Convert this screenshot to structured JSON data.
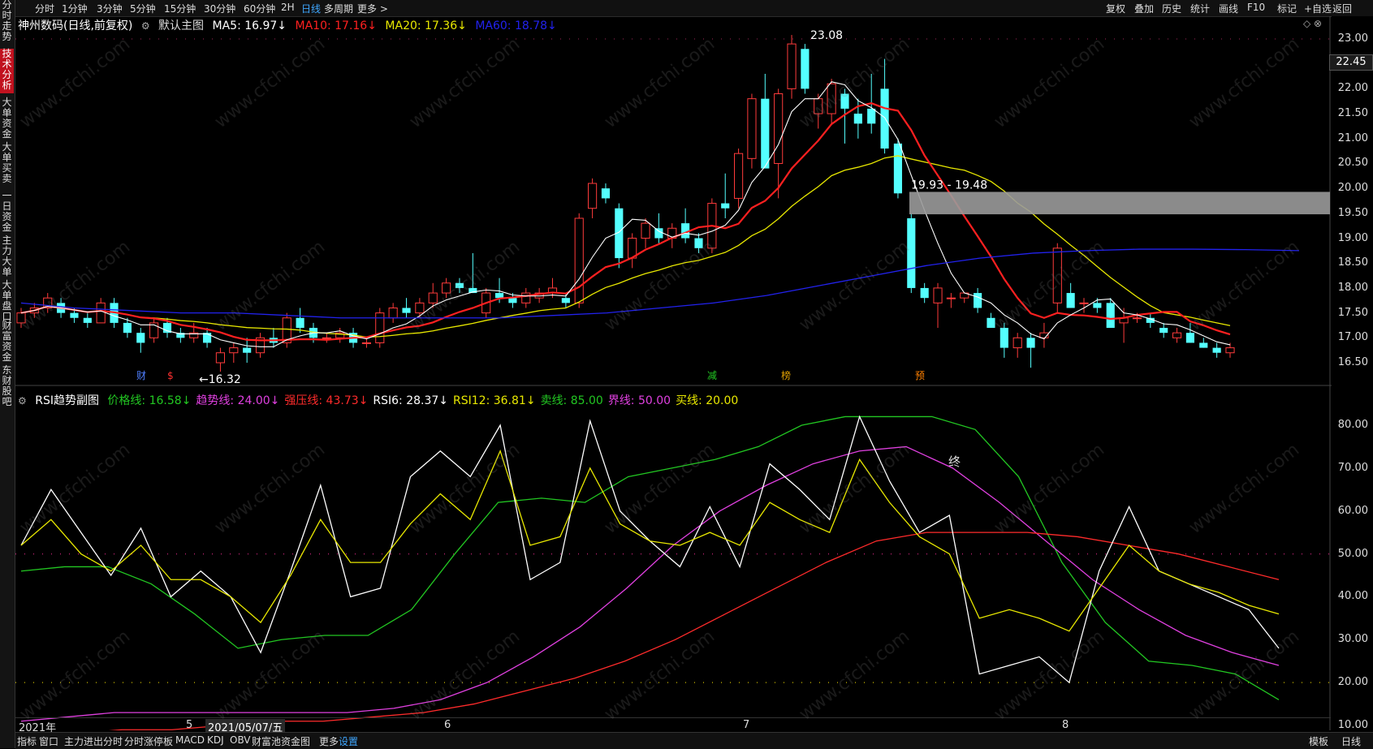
{
  "left_tabs": [
    {
      "label": "分时走势",
      "active": false
    },
    {
      "label": "技术分析",
      "active": true
    },
    {
      "label": "大单资金",
      "active": false
    },
    {
      "label": "大单买卖",
      "active": false
    },
    {
      "label": "一日资金",
      "active": false
    },
    {
      "label": "主力大单",
      "active": false
    },
    {
      "label": "大单盘口",
      "active": false
    },
    {
      "label": "财富资金",
      "active": false
    },
    {
      "label": "东财股吧",
      "active": false
    }
  ],
  "toolbar": {
    "periods": [
      "分时",
      "1分钟",
      "3分钟",
      "5分钟",
      "15分钟",
      "30分钟",
      "60分钟",
      "2H",
      "日线",
      "多周期",
      "更多 >"
    ],
    "active_period": "日线",
    "right": [
      "复权",
      "叠加",
      "历史",
      "统计",
      "画线",
      "F10",
      "标记",
      "+自选",
      "返回"
    ]
  },
  "main_legend": {
    "title": "神州数码(日线,前复权)",
    "indicator": "默认主图",
    "ma5": "MA5: 16.97↓",
    "ma10": "MA10: 17.16↓",
    "ma20": "MA20: 17.36↓",
    "ma60": "MA60: 18.78↓"
  },
  "sub_legend": {
    "title": "RSI趋势副图",
    "items": [
      {
        "text": "价格线: 16.58↓",
        "color": "#22c722"
      },
      {
        "text": "趋势线: 24.00↓",
        "color": "#e040e0"
      },
      {
        "text": "强压线: 43.73↓",
        "color": "#ff2b2b"
      },
      {
        "text": "RSI6: 28.37↓",
        "color": "#ffffff"
      },
      {
        "text": "RSI12: 36.81↓",
        "color": "#e8e800"
      },
      {
        "text": "卖线: 85.00",
        "color": "#22c722"
      },
      {
        "text": "界线: 50.00",
        "color": "#e040e0"
      },
      {
        "text": "买线: 20.00",
        "color": "#e8e800"
      }
    ]
  },
  "price_axis": [
    "23.00",
    "22.50",
    "22.00",
    "21.50",
    "21.00",
    "20.50",
    "20.00",
    "19.50",
    "19.00",
    "18.50",
    "18.00",
    "17.50",
    "17.00",
    "16.50"
  ],
  "current_price": "22.45",
  "rsi_axis": [
    "80.00",
    "70.00",
    "60.00",
    "50.00",
    "40.00",
    "30.00",
    "20.00",
    "10.00"
  ],
  "annotations": {
    "high": "23.08",
    "low": "←16.32",
    "gap": "19.93 - 19.48",
    "end_mark": "终",
    "markers": [
      "财",
      "$",
      "减",
      "榜",
      "预"
    ]
  },
  "date_axis": [
    "2021年",
    "5",
    "2021/05/07/五",
    "6",
    "7",
    "8"
  ],
  "bottom_tabs": [
    "指标",
    "窗口",
    "主力进出分时",
    "分时涨停板",
    "MACD",
    "KDJ",
    "OBV",
    "财富池资金图",
    "更多",
    "设置"
  ],
  "bottom_active": "设置",
  "bottom_right": [
    "模板",
    "日线"
  ],
  "watermark": "www.cfchi.com",
  "colors": {
    "up": "#ff3b3b",
    "down": "#54ffff",
    "ma5": "#ffffff",
    "ma10": "#ff2020",
    "ma20": "#e8e800",
    "ma60": "#2222ee"
  },
  "chart_data": {
    "type": "candlestick",
    "y_range": [
      16.2,
      23.3
    ],
    "candles": [
      [
        17.3,
        17.6,
        17.2,
        17.5
      ],
      [
        17.5,
        17.7,
        17.4,
        17.6
      ],
      [
        17.6,
        17.9,
        17.5,
        17.8
      ],
      [
        17.7,
        17.8,
        17.4,
        17.5
      ],
      [
        17.5,
        17.6,
        17.3,
        17.4
      ],
      [
        17.4,
        17.5,
        17.2,
        17.3
      ],
      [
        17.3,
        17.8,
        17.3,
        17.7
      ],
      [
        17.7,
        17.8,
        17.2,
        17.3
      ],
      [
        17.3,
        17.4,
        17.0,
        17.1
      ],
      [
        17.1,
        17.2,
        16.7,
        16.9
      ],
      [
        17.0,
        17.4,
        16.9,
        17.3
      ],
      [
        17.3,
        17.4,
        17.0,
        17.1
      ],
      [
        17.1,
        17.2,
        16.9,
        17.0
      ],
      [
        17.0,
        17.3,
        16.9,
        17.1
      ],
      [
        17.1,
        17.2,
        16.8,
        16.9
      ],
      [
        16.5,
        16.8,
        16.32,
        16.7
      ],
      [
        16.7,
        16.9,
        16.5,
        16.8
      ],
      [
        16.8,
        17.0,
        16.5,
        16.7
      ],
      [
        16.7,
        17.1,
        16.6,
        17.0
      ],
      [
        17.0,
        17.2,
        16.8,
        16.9
      ],
      [
        16.9,
        17.5,
        16.8,
        17.4
      ],
      [
        17.4,
        17.6,
        17.1,
        17.2
      ],
      [
        17.2,
        17.3,
        16.9,
        17.0
      ],
      [
        17.0,
        17.1,
        16.9,
        17.0
      ],
      [
        17.0,
        17.2,
        16.9,
        17.1
      ],
      [
        17.1,
        17.2,
        16.8,
        16.9
      ],
      [
        16.9,
        17.0,
        16.8,
        16.9
      ],
      [
        16.9,
        17.6,
        16.8,
        17.5
      ],
      [
        17.4,
        17.7,
        17.3,
        17.6
      ],
      [
        17.6,
        17.8,
        17.4,
        17.5
      ],
      [
        17.5,
        17.8,
        17.4,
        17.7
      ],
      [
        17.7,
        18.1,
        17.6,
        17.9
      ],
      [
        17.9,
        18.2,
        17.8,
        18.1
      ],
      [
        18.1,
        18.2,
        17.9,
        18.0
      ],
      [
        18.0,
        18.7,
        17.9,
        17.9
      ],
      [
        17.5,
        18.0,
        17.4,
        17.9
      ],
      [
        17.9,
        18.2,
        17.7,
        17.8
      ],
      [
        17.8,
        17.9,
        17.6,
        17.7
      ],
      [
        17.7,
        18.0,
        17.6,
        17.9
      ],
      [
        17.8,
        18.0,
        17.7,
        17.9
      ],
      [
        17.9,
        18.2,
        17.8,
        18.0
      ],
      [
        17.8,
        17.9,
        17.6,
        17.7
      ],
      [
        17.7,
        19.5,
        17.6,
        19.4
      ],
      [
        19.6,
        20.2,
        19.4,
        20.1
      ],
      [
        20.0,
        20.1,
        19.7,
        19.8
      ],
      [
        19.6,
        19.7,
        18.4,
        18.6
      ],
      [
        18.6,
        19.1,
        18.4,
        19.0
      ],
      [
        19.0,
        19.4,
        18.8,
        19.3
      ],
      [
        19.2,
        19.5,
        18.9,
        19.0
      ],
      [
        19.0,
        19.3,
        18.8,
        19.2
      ],
      [
        19.3,
        19.6,
        18.9,
        19.0
      ],
      [
        19.0,
        19.1,
        18.7,
        18.8
      ],
      [
        18.8,
        19.8,
        18.7,
        19.7
      ],
      [
        19.7,
        20.3,
        19.4,
        19.6
      ],
      [
        19.8,
        20.8,
        19.6,
        20.7
      ],
      [
        20.6,
        21.9,
        20.4,
        21.8
      ],
      [
        21.8,
        22.3,
        20.6,
        20.4
      ],
      [
        20.5,
        22.0,
        19.8,
        21.9
      ],
      [
        22.0,
        23.08,
        21.8,
        22.9
      ],
      [
        22.8,
        22.9,
        21.9,
        22.0
      ],
      [
        21.5,
        21.9,
        21.2,
        21.8
      ],
      [
        21.5,
        22.2,
        21.3,
        22.1
      ],
      [
        21.9,
        22.0,
        20.9,
        21.6
      ],
      [
        21.5,
        21.8,
        21.0,
        21.3
      ],
      [
        21.6,
        22.3,
        21.1,
        21.3
      ],
      [
        22.0,
        22.6,
        20.7,
        20.8
      ],
      [
        20.9,
        21.0,
        19.8,
        19.9
      ],
      [
        19.4,
        19.5,
        17.9,
        18.0
      ],
      [
        18.0,
        18.1,
        17.7,
        17.8
      ],
      [
        17.7,
        18.1,
        17.2,
        18.0
      ],
      [
        17.8,
        17.9,
        17.6,
        17.8
      ],
      [
        17.8,
        17.9,
        17.7,
        17.9
      ],
      [
        17.9,
        18.0,
        17.5,
        17.6
      ],
      [
        17.4,
        17.5,
        17.2,
        17.2
      ],
      [
        17.2,
        17.3,
        16.6,
        16.8
      ],
      [
        16.8,
        17.1,
        16.6,
        17.0
      ],
      [
        17.0,
        17.1,
        16.4,
        16.8
      ],
      [
        17.0,
        17.3,
        16.8,
        17.1
      ],
      [
        17.7,
        18.9,
        17.5,
        18.8
      ],
      [
        17.9,
        18.1,
        17.6,
        17.6
      ],
      [
        17.7,
        17.8,
        17.5,
        17.7
      ],
      [
        17.7,
        17.8,
        17.5,
        17.6
      ],
      [
        17.7,
        17.8,
        17.2,
        17.2
      ],
      [
        17.3,
        17.6,
        16.9,
        17.4
      ],
      [
        17.4,
        17.5,
        17.3,
        17.4
      ],
      [
        17.4,
        17.5,
        17.2,
        17.3
      ],
      [
        17.2,
        17.3,
        17.0,
        17.1
      ],
      [
        17.0,
        17.2,
        16.9,
        17.1
      ],
      [
        17.1,
        17.3,
        16.9,
        16.9
      ],
      [
        16.9,
        17.0,
        16.8,
        16.8
      ],
      [
        16.8,
        16.9,
        16.6,
        16.7
      ],
      [
        16.7,
        16.9,
        16.6,
        16.8
      ]
    ],
    "ma60": [
      17.7,
      17.6,
      17.55,
      17.5,
      17.5,
      17.45,
      17.4,
      17.4,
      17.4,
      17.4,
      17.45,
      17.5,
      17.6,
      17.7,
      17.85,
      18.05,
      18.25,
      18.45,
      18.6,
      18.7,
      18.75,
      18.78,
      18.78,
      18.77,
      18.75
    ],
    "rsi_series": [
      {
        "name": "价格线",
        "color": "#22c722",
        "values": [
          46,
          47,
          47,
          43,
          36,
          28,
          30,
          31,
          31,
          37,
          50,
          62,
          63,
          62,
          68,
          70,
          72,
          75,
          80,
          82,
          82,
          82,
          79,
          68,
          48,
          34,
          25,
          24,
          22,
          16
        ]
      },
      {
        "name": "趋势线",
        "color": "#e040e0",
        "values": [
          11,
          12,
          13,
          13,
          13,
          13,
          13,
          13,
          14,
          16,
          20,
          26,
          33,
          42,
          52,
          60,
          66,
          71,
          74,
          75,
          70,
          62,
          53,
          44,
          37,
          31,
          27,
          24
        ]
      },
      {
        "name": "强压线",
        "color": "#ff2b2b",
        "values": [
          7,
          8,
          9,
          9,
          10,
          11,
          11,
          12,
          13,
          15,
          18,
          21,
          25,
          30,
          36,
          42,
          48,
          53,
          55,
          55,
          55,
          54,
          52,
          50,
          47,
          44
        ]
      },
      {
        "name": "RSI6",
        "color": "#ffffff",
        "values": [
          52,
          65,
          55,
          45,
          56,
          40,
          46,
          40,
          27,
          46,
          66,
          40,
          42,
          68,
          74,
          68,
          80,
          44,
          48,
          81,
          60,
          53,
          47,
          61,
          47,
          71,
          65,
          58,
          82,
          67,
          55,
          59,
          22,
          24,
          26,
          20,
          46,
          61,
          46,
          43,
          40,
          37,
          28
        ]
      },
      {
        "name": "RSI12",
        "color": "#e8e800",
        "values": [
          52,
          58,
          50,
          46,
          52,
          44,
          44,
          40,
          34,
          45,
          58,
          48,
          48,
          57,
          64,
          58,
          74,
          52,
          54,
          70,
          57,
          53,
          52,
          55,
          52,
          62,
          58,
          55,
          72,
          62,
          54,
          50,
          35,
          37,
          35,
          32,
          42,
          52,
          46,
          43,
          41,
          38,
          36
        ]
      }
    ]
  }
}
